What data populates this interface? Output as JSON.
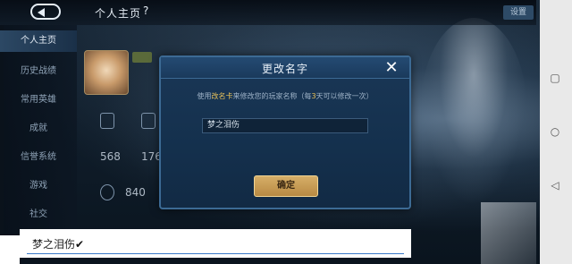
{
  "topbar": {
    "title": "个人主页",
    "help": "?",
    "right_button": "设置"
  },
  "left_menu": [
    {
      "label": "个人主页",
      "active": true
    },
    {
      "label": "历史战绩",
      "active": false
    },
    {
      "label": "常用英雄",
      "active": false
    },
    {
      "label": "成就",
      "active": false
    },
    {
      "label": "信誉系统",
      "active": false
    },
    {
      "label": "游戏",
      "active": false
    },
    {
      "label": "社交",
      "active": false
    }
  ],
  "stats": {
    "a_num": "568",
    "b_num": "176",
    "c_num": "840"
  },
  "dialog": {
    "title": "更改名字",
    "close": "✕",
    "desc_prefix": "使用",
    "desc_card": "改名卡",
    "desc_mid": "来修改您的玩家名称（每",
    "desc_days": "3",
    "desc_suffix": "天可以修改一次）",
    "input_value": "梦之泪伤",
    "confirm": "确定"
  },
  "entry": {
    "text": "梦之泪伤",
    "check": "✔"
  },
  "colors": {
    "accent_gold": "#d6ae68",
    "highlight": "#e9c25a",
    "dialog_bg": "#1a3756"
  },
  "icons": [
    "back-icon",
    "close-icon",
    "square-icon",
    "circle-icon",
    "triangle-icon"
  ]
}
